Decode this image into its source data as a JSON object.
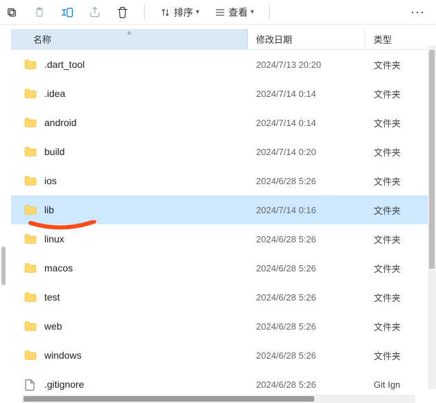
{
  "toolbar": {
    "sort_label": "排序",
    "view_label": "查看"
  },
  "columns": {
    "name": "名称",
    "date": "修改日期",
    "type": "类型"
  },
  "rows": [
    {
      "name": ".dart_tool",
      "date": "2024/7/13 20:20",
      "type": "文件夹",
      "kind": "folder",
      "selected": false
    },
    {
      "name": ".idea",
      "date": "2024/7/14 0:14",
      "type": "文件夹",
      "kind": "folder",
      "selected": false
    },
    {
      "name": "android",
      "date": "2024/7/14 0:14",
      "type": "文件夹",
      "kind": "folder",
      "selected": false
    },
    {
      "name": "build",
      "date": "2024/7/14 0:20",
      "type": "文件夹",
      "kind": "folder",
      "selected": false
    },
    {
      "name": "ios",
      "date": "2024/6/28 5:26",
      "type": "文件夹",
      "kind": "folder",
      "selected": false
    },
    {
      "name": "lib",
      "date": "2024/7/14 0:16",
      "type": "文件夹",
      "kind": "folder",
      "selected": true
    },
    {
      "name": "linux",
      "date": "2024/6/28 5:26",
      "type": "文件夹",
      "kind": "folder",
      "selected": false
    },
    {
      "name": "macos",
      "date": "2024/6/28 5:26",
      "type": "文件夹",
      "kind": "folder",
      "selected": false
    },
    {
      "name": "test",
      "date": "2024/6/28 5:26",
      "type": "文件夹",
      "kind": "folder",
      "selected": false
    },
    {
      "name": "web",
      "date": "2024/6/28 5:26",
      "type": "文件夹",
      "kind": "folder",
      "selected": false
    },
    {
      "name": "windows",
      "date": "2024/6/28 5:26",
      "type": "文件夹",
      "kind": "folder",
      "selected": false
    },
    {
      "name": ".gitignore",
      "date": "2024/6/28 5:26",
      "type": "Git Ign",
      "kind": "file",
      "selected": false
    }
  ]
}
